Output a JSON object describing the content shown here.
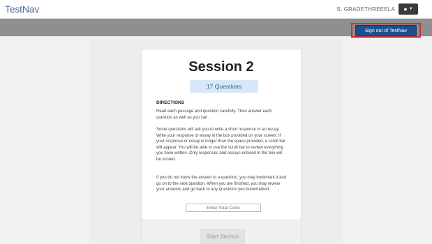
{
  "header": {
    "logo": "TestNav",
    "username": "S. GRADETHREEELA",
    "user_menu_icon": "user-icon",
    "signout_label": "Sign out of TestNav"
  },
  "session": {
    "title": "Session 2",
    "question_count": "17 Questions",
    "directions_heading": "DIRECTIONS",
    "paragraphs": [
      "Read each passage and question carefully. Then answer each question as well as you can.",
      "Some questions will ask you to write a short response or an essay. Write your response or essay in the box provided on your screen. If your response or essay is longer than the space provided, a scroll bar will appear. You will be able to use the scroll bar to review everything you have written. Only responses and essays entered in the box will be scored.",
      "If you do not know the answer to a question, you may bookmark it and go on to the next question. When you are finished, you may review your answers and go back to any questions you bookmarked."
    ],
    "seal_placeholder": "Enter Seal Code",
    "start_label": "Start Section"
  },
  "colors": {
    "signout_bg": "#1b4f8f",
    "highlight": "#d32f2f",
    "pill_bg": "#d6e8f7"
  }
}
